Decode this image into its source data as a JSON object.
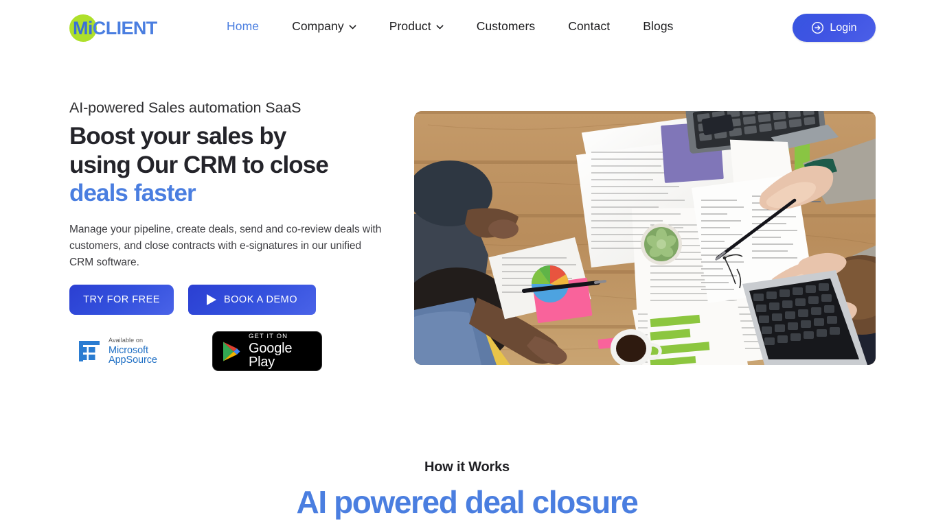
{
  "brand": {
    "logo_mi": "Mi",
    "logo_client": "CLIENT",
    "circle_color": "#aee02b",
    "accent_blue": "#4a7ee0",
    "button_blue": "#3350dd"
  },
  "nav": {
    "items": [
      {
        "label": "Home",
        "active": true,
        "has_dropdown": false
      },
      {
        "label": "Company",
        "active": false,
        "has_dropdown": true
      },
      {
        "label": "Product",
        "active": false,
        "has_dropdown": true
      },
      {
        "label": "Customers",
        "active": false,
        "has_dropdown": false
      },
      {
        "label": "Contact",
        "active": false,
        "has_dropdown": false
      },
      {
        "label": "Blogs",
        "active": false,
        "has_dropdown": false
      }
    ],
    "login_label": "Login",
    "login_icon": "arrow-right-circle-icon"
  },
  "hero": {
    "eyebrow": "AI-powered Sales automation SaaS",
    "headline_line1": "Boost your sales by",
    "headline_line2": "using Our CRM to close",
    "headline_accent": "deals faster",
    "subtext": "Manage your pipeline, create deals, send and co-review deals with customers, and close contracts with e-signatures in our unified CRM software.",
    "cta_primary": "TRY FOR FREE",
    "cta_secondary": "BOOK A DEMO",
    "cta_secondary_icon": "play-icon",
    "image_alt": "Team reviewing printed reports and contracts on a wooden table from above"
  },
  "badges": {
    "microsoft": {
      "small_text": "Available on",
      "name": "Microsoft AppSource",
      "icon": "microsoft-grid-icon"
    },
    "google": {
      "small_text": "GET IT ON",
      "name": "Google Play",
      "icon": "google-play-icon"
    }
  },
  "how_it_works": {
    "label": "How it Works",
    "title": "AI powered deal closure"
  }
}
